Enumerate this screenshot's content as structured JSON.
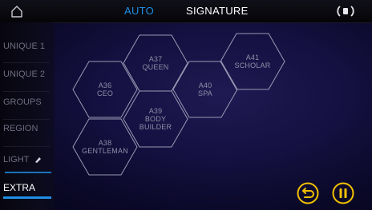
{
  "header": {
    "tab_auto": "AUTO",
    "tab_signature": "SIGNATURE",
    "home_icon": "home-icon",
    "speaker_icon": "speaker-icon"
  },
  "sidebar": {
    "items": [
      {
        "label": "UNIQUE 1"
      },
      {
        "label": "UNIQUE 2"
      },
      {
        "label": "GROUPS"
      },
      {
        "label": "REGION"
      },
      {
        "label": "LIGHT"
      },
      {
        "label": "EXTRA"
      }
    ],
    "active": "EXTRA"
  },
  "hexes": [
    {
      "code": "A37",
      "name": "QUEEN"
    },
    {
      "code": "A41",
      "name": "SCHOLAR"
    },
    {
      "code": "A36",
      "name": "CEO"
    },
    {
      "code": "A40",
      "name": "SPA"
    },
    {
      "code": "A39",
      "name": "BODY BUILDER",
      "line1": "BODY",
      "line2": "BUILDER"
    },
    {
      "code": "A38",
      "name": "GENTLEMAN"
    }
  ],
  "controls": {
    "replay_icon": "replay-icon",
    "pause_icon": "pause-icon"
  },
  "colors": {
    "accent": "#1f8fe6",
    "pause_ring": "#f2c200",
    "replay_ring": "#f2c200",
    "hex_stroke": "#9a9ab4"
  }
}
